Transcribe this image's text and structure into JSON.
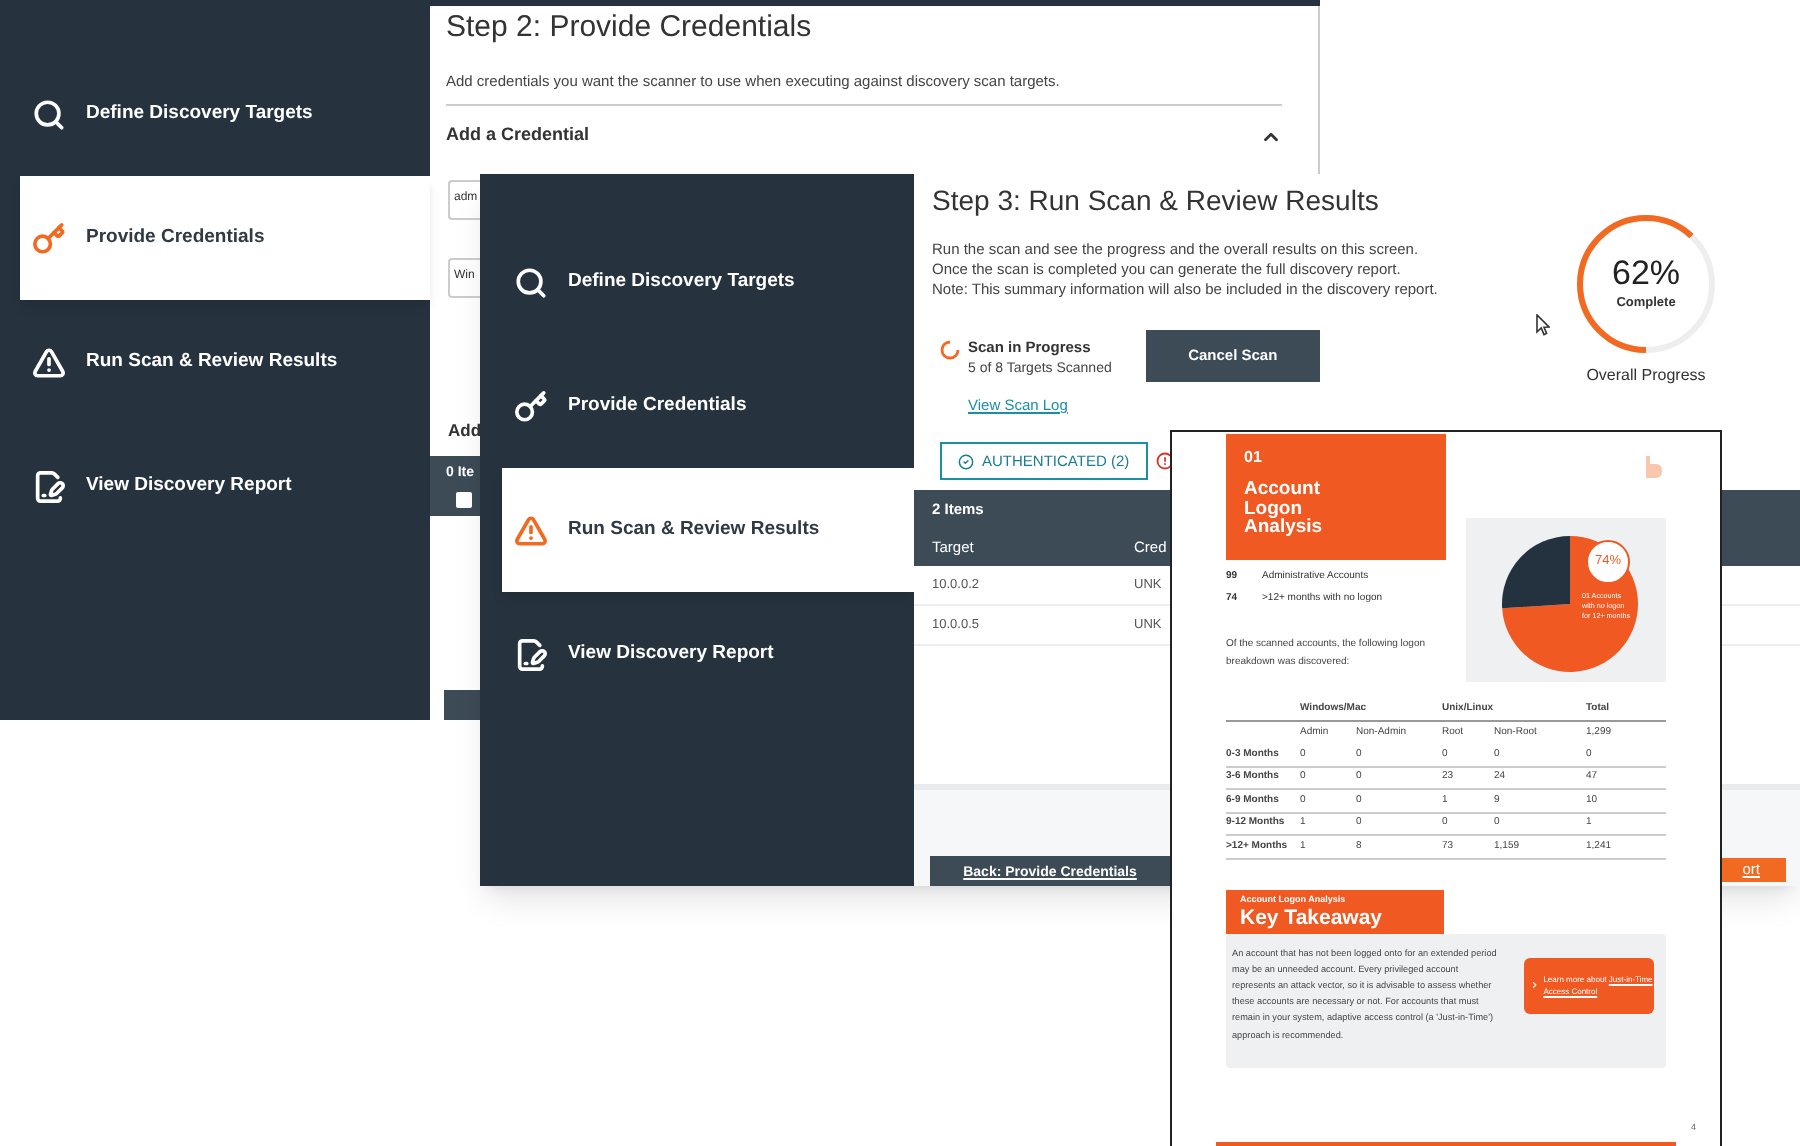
{
  "window_step2": {
    "sidebar": [
      {
        "label": "Define Discovery Targets",
        "kind": "search",
        "selected": false
      },
      {
        "label": "Provide Credentials",
        "kind": "key",
        "selected": true
      },
      {
        "label": "Run Scan & Review Results",
        "kind": "warning",
        "selected": false
      },
      {
        "label": "View Discovery Report",
        "kind": "edit",
        "selected": false
      }
    ],
    "title": "Step 2: Provide Credentials",
    "description": "Add credentials you want the scanner to use when executing against discovery scan targets.",
    "section": {
      "title": "Add a Credential",
      "expanded": true
    },
    "fields": [
      {
        "value": "adm"
      },
      {
        "value": "Win"
      }
    ],
    "subsection": "Add",
    "list_header": "0 Ite",
    "select_all": {
      "checked": false
    }
  },
  "window_step3": {
    "sidebar": [
      {
        "label": "Define Discovery Targets",
        "kind": "search",
        "selected": false
      },
      {
        "label": "Provide Credentials",
        "kind": "key",
        "selected": false
      },
      {
        "label": "Run Scan & Review Results",
        "kind": "warning",
        "selected": true
      },
      {
        "label": "View Discovery Report",
        "kind": "edit",
        "selected": false
      }
    ],
    "title": "Step 3: Run Scan & Review Results",
    "description": [
      "Run the scan and see the progress and the overall results on this screen.",
      "Once the scan is completed you can generate the full discovery report.",
      "Note: This summary information will also be included in the discovery report."
    ],
    "scan_status": {
      "title": "Scan in Progress",
      "detail": "5 of 8 Targets Scanned"
    },
    "cancel_button": "Cancel Scan",
    "log_link": "View Scan Log",
    "progress": {
      "value": "62%",
      "caption": "Complete",
      "label": "Overall Progress",
      "level": 0.62
    },
    "tabs": [
      {
        "label": "AUTHENTICATED (2)",
        "selected": true
      }
    ],
    "table": {
      "count": "2 Items",
      "columns": [
        "Target",
        "Cred"
      ],
      "rows": [
        [
          "10.0.0.2",
          "UNK"
        ],
        [
          "10.0.0.5",
          "UNK"
        ]
      ]
    },
    "back_button": "Back: Provide Credentials",
    "report_button": "ort"
  },
  "report_page": {
    "section_number": "01",
    "section_title": "Account Logon Analysis",
    "stats": [
      {
        "value": "99",
        "label": "Administrative Accounts"
      },
      {
        "value": "74",
        "label": ">12+ months with no logon"
      }
    ],
    "intro": "Of the scanned accounts, the following logon breakdown was discovered:",
    "pie": {
      "label": "74%",
      "caption": "01 Accounts with no logon for 12+ months",
      "chart_data": {
        "type": "pie",
        "values": [
          74,
          26
        ]
      }
    },
    "table": {
      "groups": [
        "Windows/Mac",
        "Unix/Linux",
        "Total"
      ],
      "subheaders": [
        "Admin",
        "Non-Admin",
        "Root",
        "Non-Root",
        "1,299"
      ],
      "rows": [
        {
          "label": "0-3 Months",
          "cells": [
            "0",
            "0",
            "0",
            "0",
            "0"
          ]
        },
        {
          "label": "3-6 Months",
          "cells": [
            "0",
            "0",
            "23",
            "24",
            "47"
          ]
        },
        {
          "label": "6-9 Months",
          "cells": [
            "0",
            "0",
            "1",
            "9",
            "10"
          ]
        },
        {
          "label": "9-12 Months",
          "cells": [
            "1",
            "0",
            "0",
            "0",
            "1"
          ]
        },
        {
          "label": ">12+ Months",
          "cells": [
            "1",
            "8",
            "73",
            "1,159",
            "1,241"
          ]
        }
      ]
    },
    "takeaway": {
      "kicker": "Account Logon Analysis",
      "title": "Key Takeaway",
      "text": "An account that has not been logged onto for an extended period may be an unneeded account. Every privileged account represents an attack vector, so it is advisable to assess whether these accounts are necessary or not. For accounts that must remain in your system, adaptive access control (a 'Just-in-Time') approach is recommended.",
      "link_intro": "Learn more about",
      "link": "Just-in-Time Access Control"
    },
    "page_number": "4"
  }
}
